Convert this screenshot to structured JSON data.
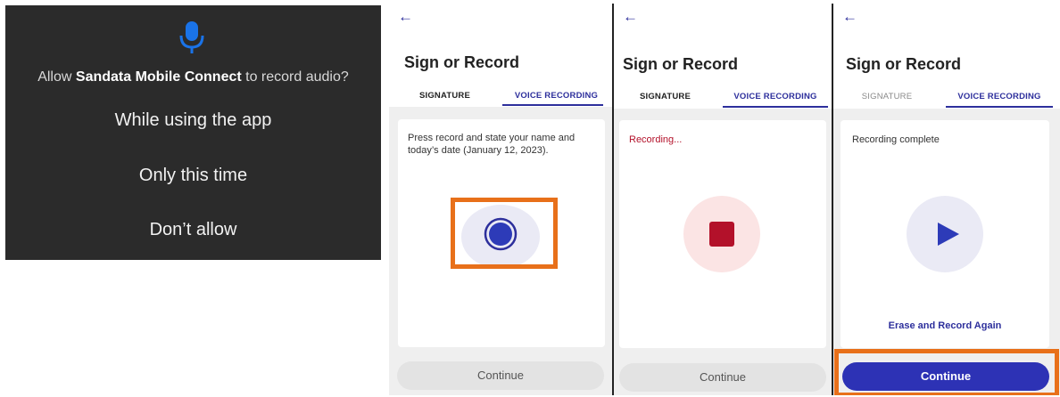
{
  "permission_dialog": {
    "prompt_prefix": "Allow",
    "app_name": "Sandata Mobile Connect",
    "prompt_suffix": "to record audio?",
    "options": [
      "While using the app",
      "Only this time",
      "Don’t allow"
    ],
    "icon": "microphone-icon",
    "accent_color": "#1a73e8"
  },
  "screen1": {
    "back_icon": "arrow-left-icon",
    "title": "Sign or Record",
    "tabs": [
      "SIGNATURE",
      "VOICE RECORDING"
    ],
    "instruction": "Press record and state your name and today’s date (January 12, 2023).",
    "record_icon": "record-icon",
    "continue_label": "Continue"
  },
  "screen2": {
    "back_icon": "arrow-left-icon",
    "title": "Sign or Record",
    "tabs": [
      "SIGNATURE",
      "VOICE RECORDING"
    ],
    "status": "Recording...",
    "stop_icon": "stop-icon",
    "continue_label": "Continue"
  },
  "screen3": {
    "back_icon": "arrow-left-icon",
    "title": "Sign or Record",
    "tabs": [
      "SIGNATURE",
      "VOICE RECORDING"
    ],
    "status": "Recording complete",
    "play_icon": "play-icon",
    "erase_label": "Erase and Record Again",
    "continue_label": "Continue"
  },
  "colors": {
    "brand": "#2d2f9c",
    "recording_red": "#b3112a",
    "highlight_orange": "#e8701a"
  }
}
